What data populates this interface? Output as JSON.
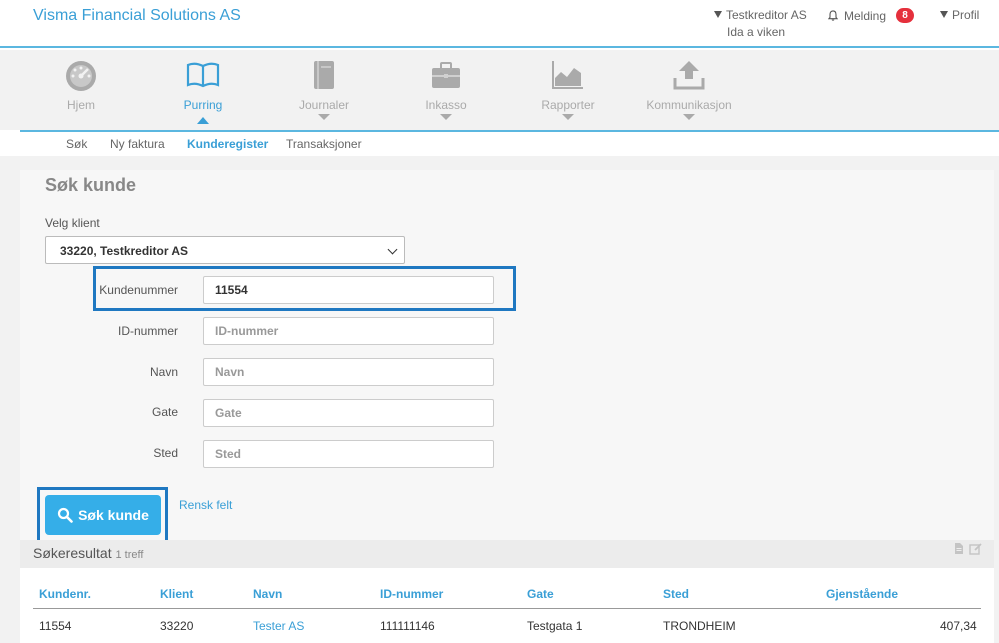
{
  "header": {
    "brand": "Visma Financial Solutions AS",
    "creditor": "Testkreditor AS",
    "user": "Ida a viken",
    "melding_label": "Melding",
    "melding_count": "8",
    "profil_label": "Profil"
  },
  "nav": {
    "items": [
      {
        "label": "Hjem",
        "icon": "speedometer-icon"
      },
      {
        "label": "Purring",
        "icon": "open-book-icon"
      },
      {
        "label": "Journaler",
        "icon": "journal-icon"
      },
      {
        "label": "Inkasso",
        "icon": "briefcase-icon"
      },
      {
        "label": "Rapporter",
        "icon": "area-chart-icon"
      },
      {
        "label": "Kommunikasjon",
        "icon": "upload-icon"
      }
    ],
    "subnav": [
      "Søk",
      "Ny faktura",
      "Kunderegister",
      "Transaksjoner"
    ]
  },
  "form": {
    "title": "Søk kunde",
    "client_label": "Velg klient",
    "client_value": "33220, Testkreditor AS",
    "fields": [
      {
        "label": "Kundenummer",
        "value": "11554",
        "placeholder": ""
      },
      {
        "label": "ID-nummer",
        "value": "",
        "placeholder": "ID-nummer"
      },
      {
        "label": "Navn",
        "value": "",
        "placeholder": "Navn"
      },
      {
        "label": "Gate",
        "value": "",
        "placeholder": "Gate"
      },
      {
        "label": "Sted",
        "value": "",
        "placeholder": "Sted"
      }
    ],
    "search_button": "Søk kunde",
    "clear_link": "Rensk felt"
  },
  "results": {
    "title": "Søkeresultat",
    "count": "1 treff",
    "columns": [
      "Kundenr.",
      "Klient",
      "Navn",
      "ID-nummer",
      "Gate",
      "Sted",
      "Gjenstående"
    ],
    "rows": [
      [
        "11554",
        "33220",
        "Tester AS",
        "111111146",
        "Testgata 1",
        "TRONDHEIM",
        "407,34"
      ]
    ]
  },
  "colors": {
    "accent": "#3a9fd6",
    "button": "#35aee8",
    "highlight": "#1f78c1",
    "badge": "#e5303c"
  }
}
